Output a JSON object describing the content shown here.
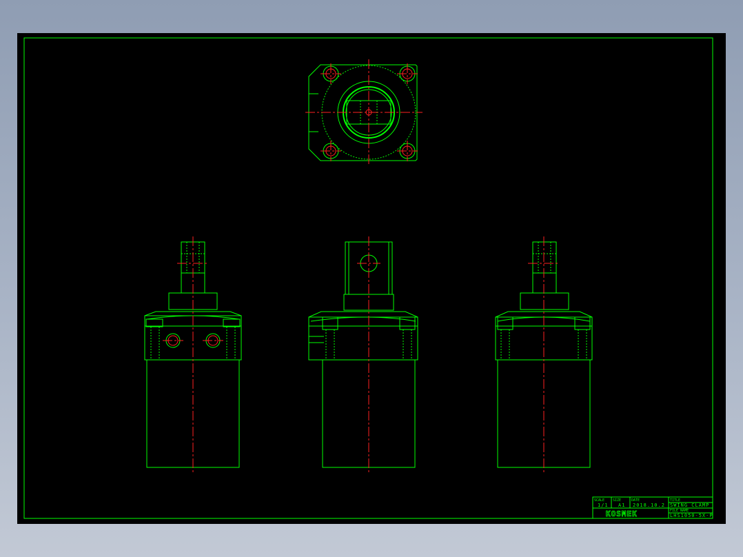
{
  "colors": {
    "background_outer": "#a4afc2",
    "paper": "#000000",
    "outline": "#00ff00",
    "centerline": "#ff2020"
  },
  "title_block": {
    "scale_header": "SCALE",
    "scale_value": "1/1",
    "size_header": "SIZE",
    "size_value": "A1",
    "date_header": "DATE",
    "date_value": "2018.10.2",
    "title_header": "TITLE",
    "title_value": "SWING CLAMP",
    "filename_header": "FILE NAME",
    "filename_value": "LHS1050-5X-P",
    "logo_text": "KOSMEK"
  }
}
